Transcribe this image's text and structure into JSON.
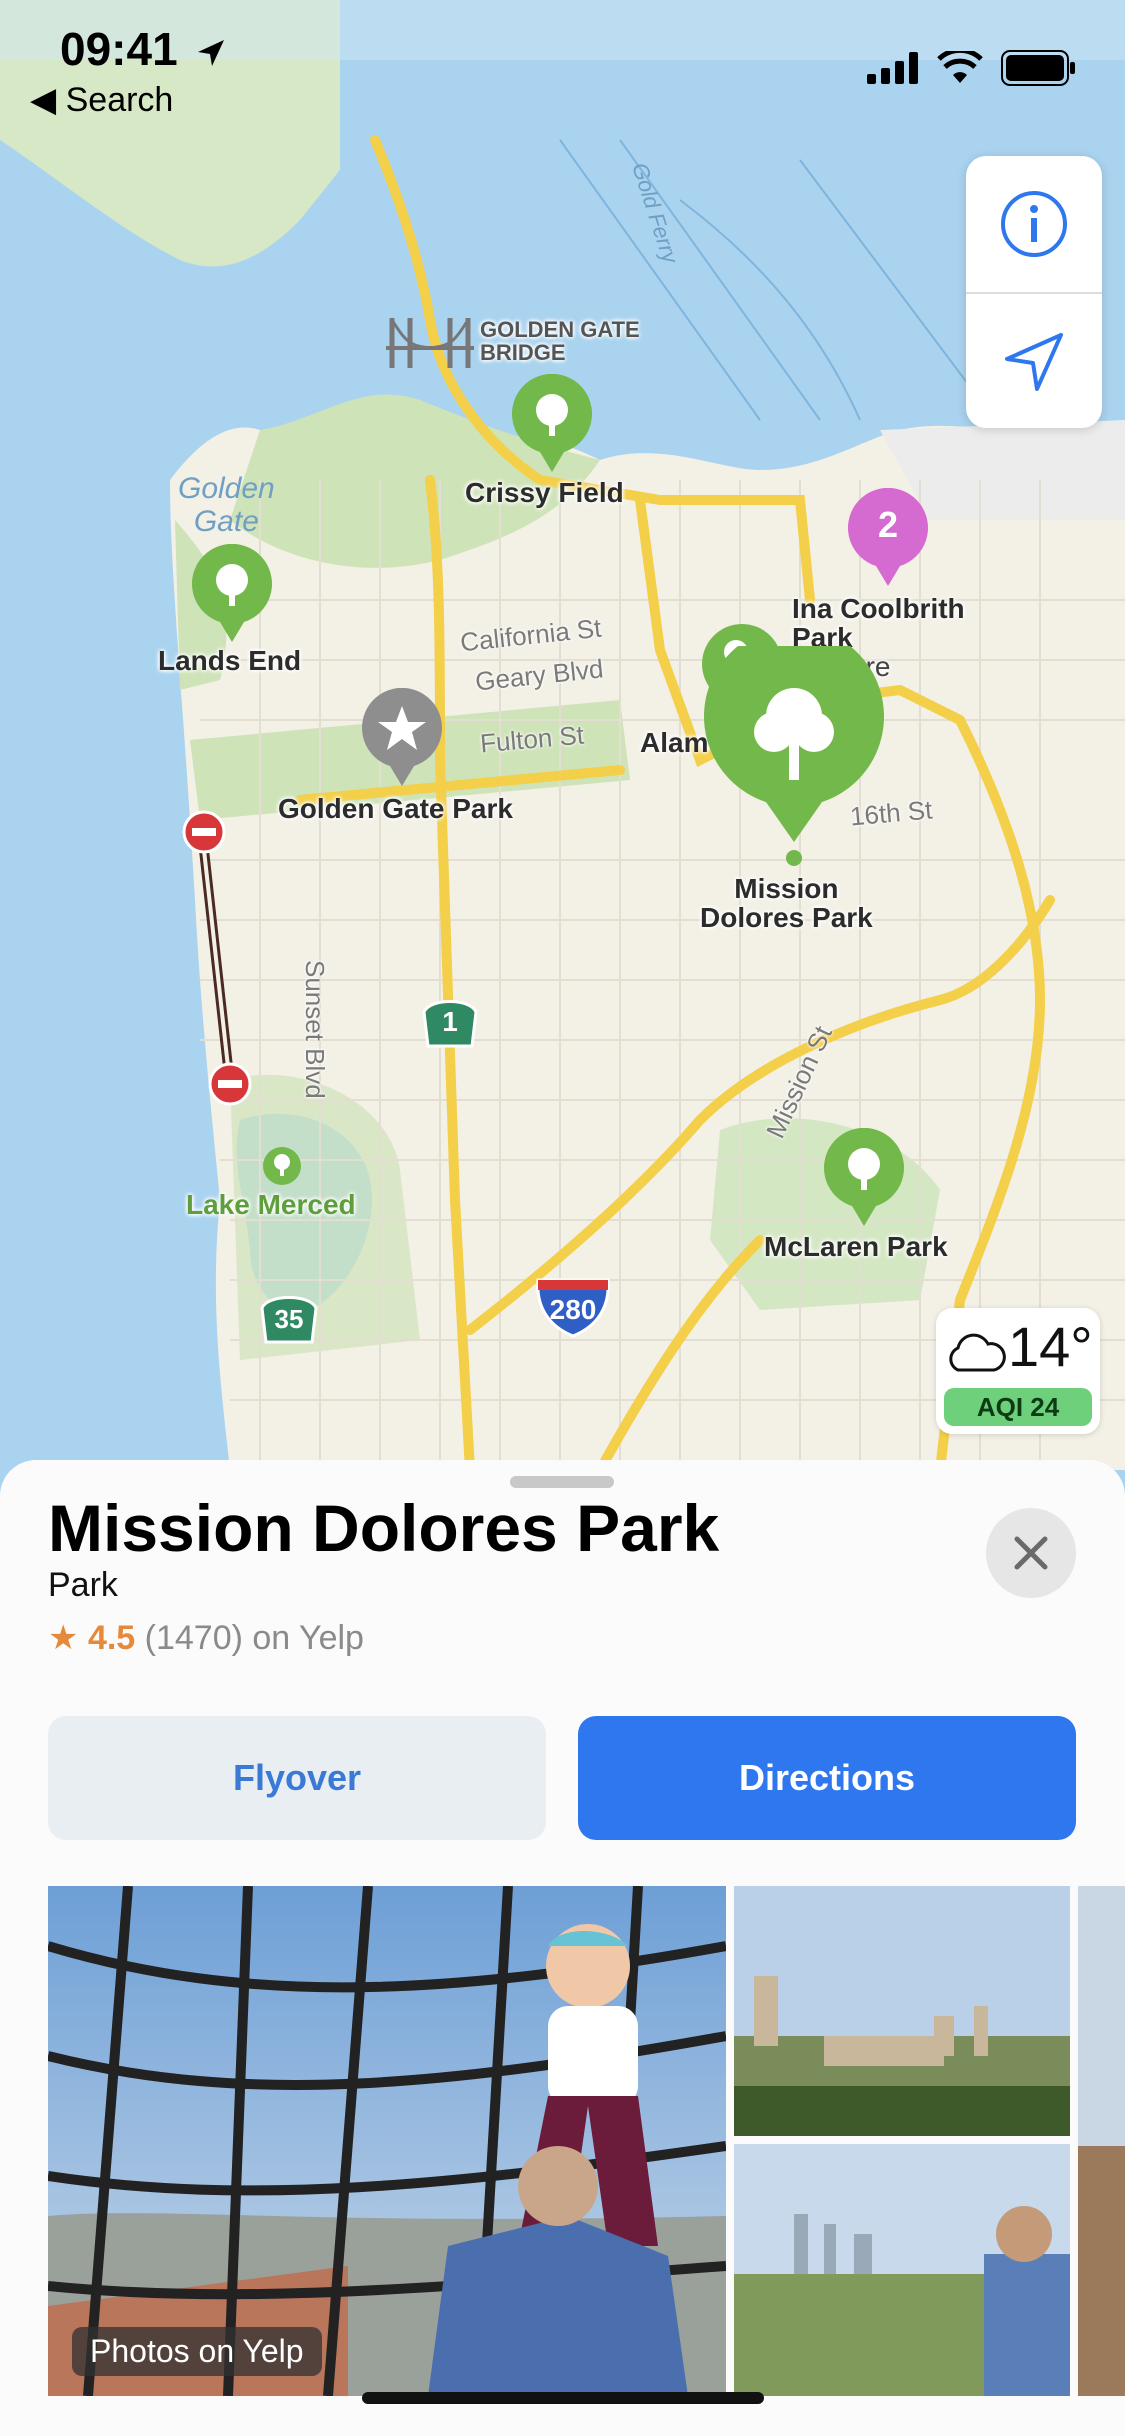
{
  "status_bar": {
    "time": "09:41",
    "back_label": "Search"
  },
  "map": {
    "landmarks": {
      "golden_gate_bridge": "GOLDEN GATE\nBRIDGE",
      "crissy_field": "Crissy Field",
      "golden_gate_water": "Golden\nGate",
      "lands_end": "Lands End",
      "ina_coolbrith": "Ina Coolbrith\nPark",
      "golden_gate_park": "Golden Gate Park",
      "mission_dolores": "Mission\nDolores Park",
      "lake_merced": "Lake Merced",
      "mclaren_park": "McLaren Park",
      "alamo": "Alam",
      "alamo_more": "ore",
      "gold_ferry": "Gold Ferry"
    },
    "streets": {
      "california": "California St",
      "geary": "Geary Blvd",
      "fulton": "Fulton St",
      "sixteenth": "16th St",
      "sunset": "Sunset Blvd",
      "mission": "Mission St"
    },
    "shields": {
      "hwy1": "1",
      "hwy35": "35",
      "i280": "280"
    },
    "cluster_count": "2"
  },
  "weather": {
    "temperature": "14°",
    "aqi": "AQI 24",
    "icon": "cloud-icon"
  },
  "place": {
    "name": "Mission Dolores Park",
    "category": "Park",
    "rating_star": "★",
    "rating": "4.5",
    "review_count": "(1470)",
    "source": "on Yelp"
  },
  "actions": {
    "flyover": "Flyover",
    "directions": "Directions"
  },
  "photos": {
    "badge": "Photos on Yelp"
  },
  "colors": {
    "accent": "#2f77ee",
    "park_green": "#72b84a",
    "rating_orange": "#e5893a",
    "cluster_pink": "#d56ad1"
  }
}
